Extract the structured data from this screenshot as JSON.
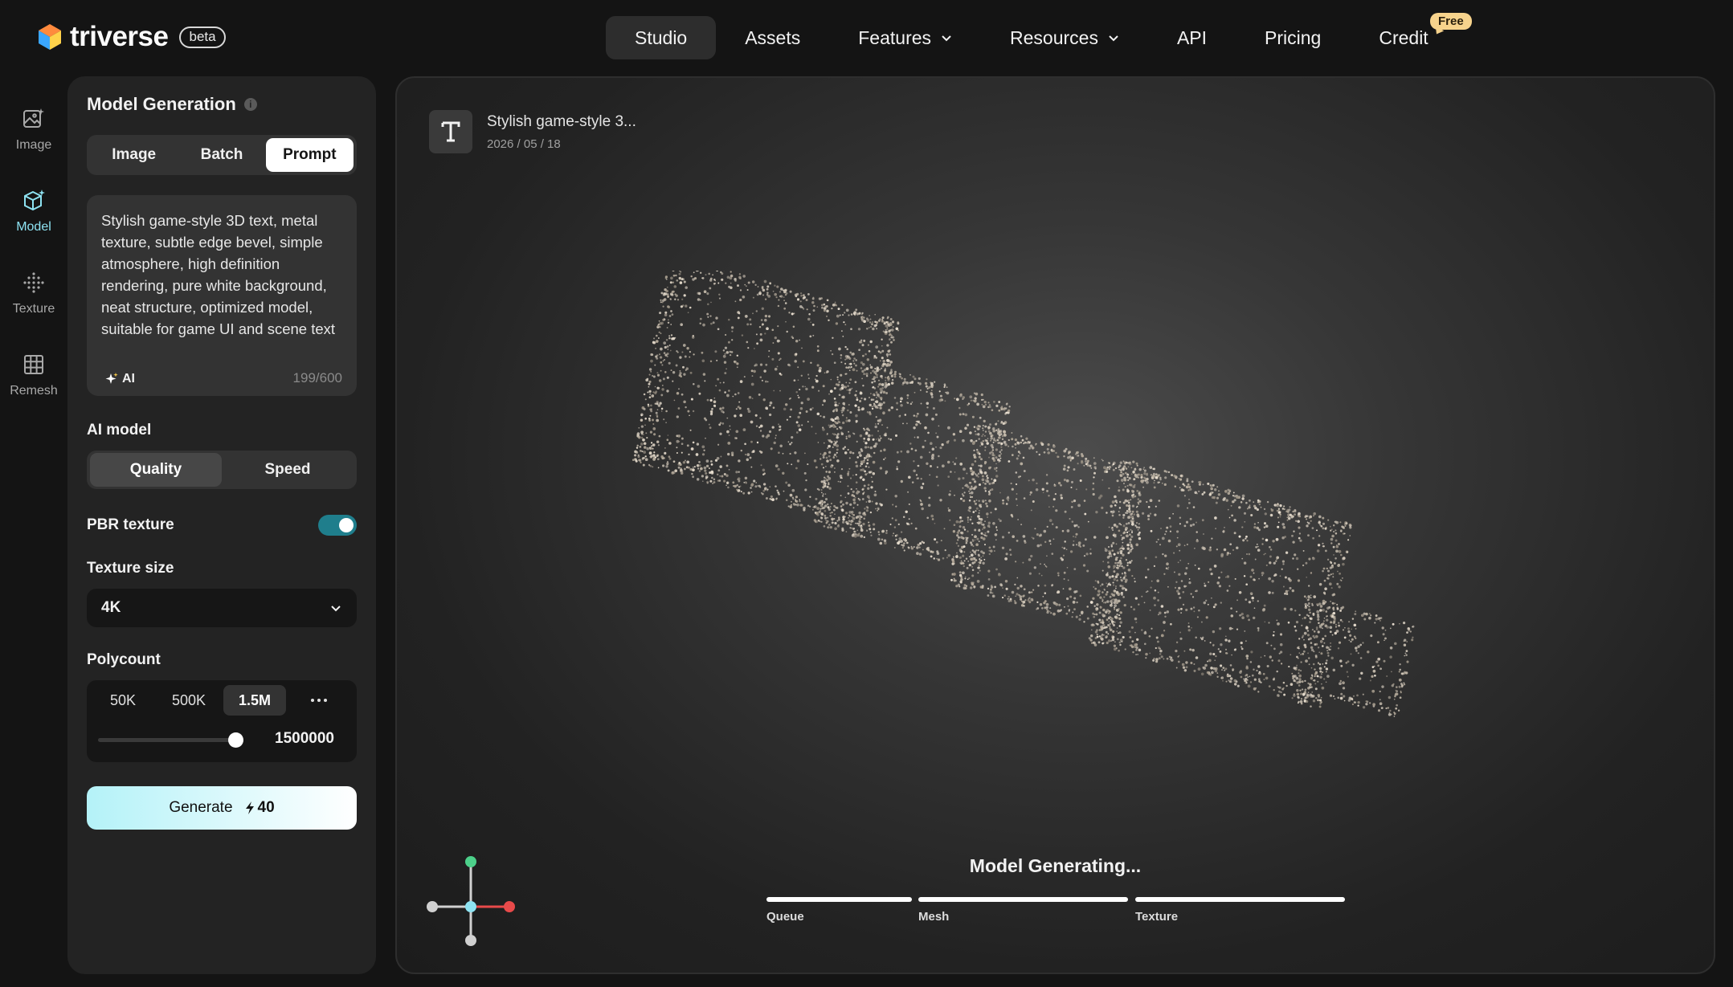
{
  "brand": {
    "name": "triverse",
    "badge": "beta"
  },
  "nav": {
    "items": [
      {
        "label": "Studio"
      },
      {
        "label": "Assets"
      },
      {
        "label": "Features"
      },
      {
        "label": "Resources"
      },
      {
        "label": "API"
      },
      {
        "label": "Pricing"
      },
      {
        "label": "Credit"
      }
    ],
    "credit_badge": "Free"
  },
  "rail": {
    "items": [
      {
        "label": "Image",
        "icon": "image-sparkle-icon"
      },
      {
        "label": "Model",
        "icon": "cube-sparkle-icon"
      },
      {
        "label": "Texture",
        "icon": "dot-grid-icon"
      },
      {
        "label": "Remesh",
        "icon": "grid-icon"
      }
    ]
  },
  "panel": {
    "title": "Model Generation",
    "modes": [
      "Image",
      "Batch",
      "Prompt"
    ],
    "active_mode": "Prompt",
    "prompt": {
      "text": "Stylish game-style 3D text, metal texture, subtle edge bevel, simple atmosphere, high definition rendering, pure white background, neat structure, optimized model, suitable for game UI and scene text",
      "ai_label": "AI",
      "count": "199/600"
    },
    "ai_model": {
      "label": "AI model",
      "options": [
        "Quality",
        "Speed"
      ],
      "selected": "Quality"
    },
    "pbr": {
      "label": "PBR texture",
      "enabled": true
    },
    "texture_size": {
      "label": "Texture size",
      "value": "4K"
    },
    "polycount": {
      "label": "Polycount",
      "options": [
        "50K",
        "500K",
        "1.5M"
      ],
      "selected": "1.5M",
      "value": "1500000",
      "slider_fraction": 1.0
    },
    "generate": {
      "label": "Generate",
      "cost": "40"
    }
  },
  "viewport": {
    "asset_title": "Stylish game-style 3...",
    "asset_date": "2026 / 05 / 18",
    "status": "Model Generating...",
    "stages": [
      {
        "label": "Queue",
        "progress": 1.0
      },
      {
        "label": "Mesh",
        "progress": 1.0
      },
      {
        "label": "Texture",
        "progress": 1.0
      }
    ]
  },
  "colors": {
    "accent": "#8ee3f2",
    "toggle": "#1f7e8c",
    "badge": "#f7d38c",
    "axis_x": "#e84a4a",
    "axis_y": "#4cd08a",
    "axis_center": "#8ee3f2"
  }
}
